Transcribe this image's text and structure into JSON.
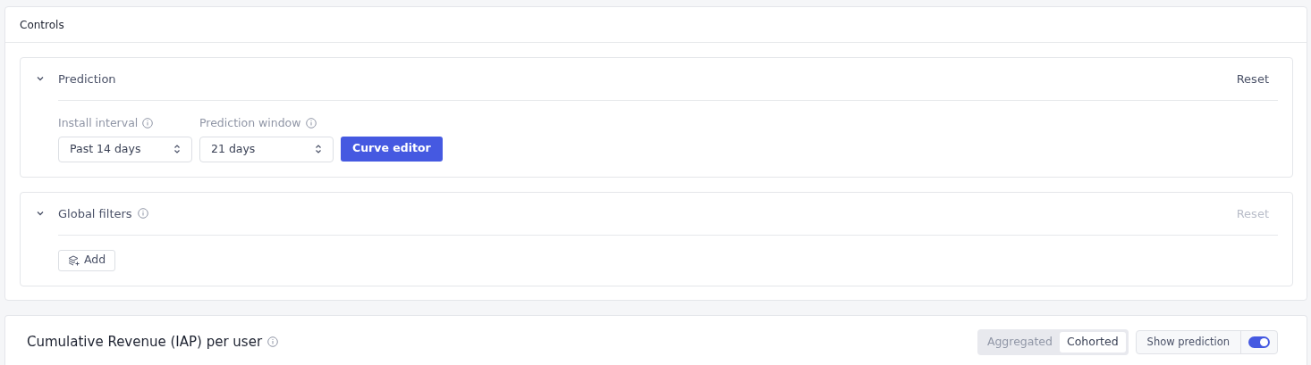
{
  "controls": {
    "title": "Controls",
    "sections": [
      {
        "title": "Prediction",
        "info": false,
        "expanded": true,
        "reset": {
          "label": "Reset",
          "disabled": false
        },
        "fields": [
          {
            "kind": "select",
            "label": "Install interval",
            "info": true,
            "value": "Past 14 days"
          },
          {
            "kind": "select",
            "label": "Prediction window",
            "info": true,
            "value": "21 days"
          },
          {
            "kind": "button",
            "label": "Curve editor"
          }
        ]
      },
      {
        "title": "Global filters",
        "info": true,
        "expanded": true,
        "reset": {
          "label": "Reset",
          "disabled": true
        },
        "fields": [
          {
            "kind": "add",
            "label": "Add"
          }
        ]
      }
    ]
  },
  "chart_panel": {
    "title": "Cumulative Revenue (IAP) per user",
    "info": true,
    "view_options": [
      {
        "label": "Aggregated",
        "selected": false
      },
      {
        "label": "Cohorted",
        "selected": true
      }
    ],
    "prediction_toggle": {
      "label": "Show prediction",
      "on": true
    }
  }
}
